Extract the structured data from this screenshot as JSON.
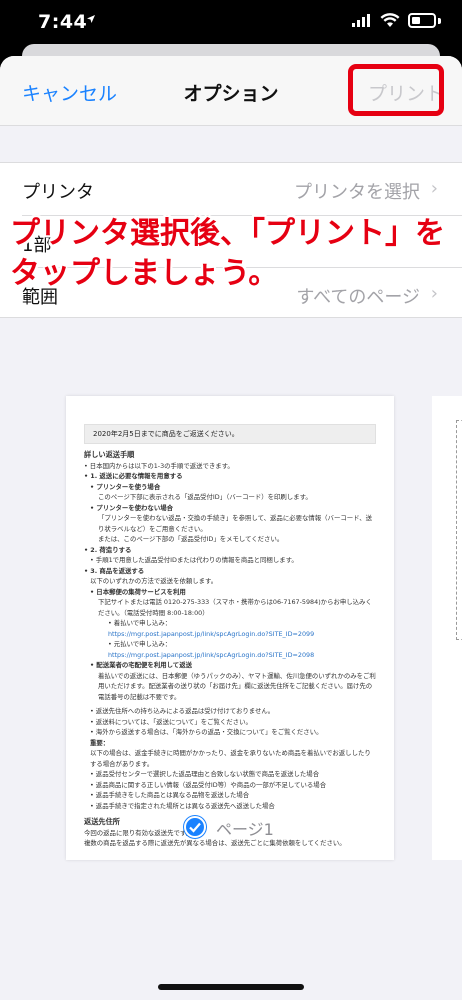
{
  "status": {
    "time": "7:44"
  },
  "nav": {
    "cancel": "キャンセル",
    "title": "オプション",
    "print": "プリント"
  },
  "rows": [
    {
      "label": "プリンタ",
      "value": "プリンタを選択"
    },
    {
      "label": "1部",
      "value": ""
    },
    {
      "label": "範囲",
      "value": "すべてのページ"
    }
  ],
  "annotation": {
    "line1": "プリンタ選択後、「プリント」を",
    "line2": "タップしましょう。"
  },
  "doc": {
    "date_line": "2020年2月5日までに商品をご返送ください。",
    "section1": "詳しい返送手順",
    "lines": [
      "• 日本国内からは以下の1-3の手順で返送できます。",
      "• 1. 返送に必要な情報を用意する",
      "• プリンターを使う場合",
      "このページ下部に表示される「返品受付ID」（バーコード）を印刷します。",
      "• プリンターを使わない場合",
      "「プリンターを使わない返品・交換の手続き」を参照して、返品に必要な情報（バーコード、送り状ラベルなど）をご用意ください。",
      "または、このページ下部の「返品受付ID」をメモしてください。",
      "• 2. 荷造りする",
      "• 手順1で用意した返品受付IDまたは代わりの情報を商品と同梱します。",
      "• 3. 商品を返送する",
      "以下のいずれかの方法で返送を依頼します。",
      "• 日本郵便の集荷サービスを利用",
      "下記サイトまたは電話 0120-275-333（スマホ・携帯からは06-7167-5984)からお申し込みください。（電話受付時間 8:00-18:00）",
      "• 着払いで申し込み：",
      "https://mgr.post.japanpost.jp/link/spcAgrLogin.do?SITE_ID=2099",
      "• 元払いで申し込み：",
      "https://mgr.post.japanpost.jp/link/spcAgrLogin.do?SITE_ID=2098",
      "• 配送業者の宅配便を利用して返送",
      "着払いでの返送には、日本郵便（ゆうパックのみ）、ヤマト運輸、佐川急便のいずれかのみをご利用いただけます。配送業者の送り状の「お届け先」欄に返送先住所をご記載ください。届け先の電話番号の記載は不要です。",
      "• 返送先住所への持ち込みによる返品は受け付けておりません。",
      "• 返送料については、「返送について」をご覧ください。",
      "• 海外から返送する場合は、「海外からの返品・交換について」をご覧ください。",
      "重要：",
      "以下の場合は、返金手続きに時間がかかったり、返金を承りないため商品を着払いでお返ししたりする場合があります。",
      "• 返品受付センターで選択した返品理由と合致しない状態で商品を返送した場合",
      "• 返品商品に関する正しい情報（返品受付ID等）や商品の一部が不足している場合",
      "• 返品手続きをした商品とは異なる品物を返送した場合",
      "• 返品手続きで指定された場所とは異なる返送先へ返送した場合"
    ],
    "section2": "返送先住所",
    "tail": [
      "今回の返品に限り有効な返送先です。",
      "複数の商品を返品する際に返送先が異なる場合は、返送先ごとに集荷依頼をしてください。"
    ]
  },
  "page_label": "ページ1",
  "colors": {
    "accent": "#1a82ff",
    "highlight": "#e60012"
  }
}
